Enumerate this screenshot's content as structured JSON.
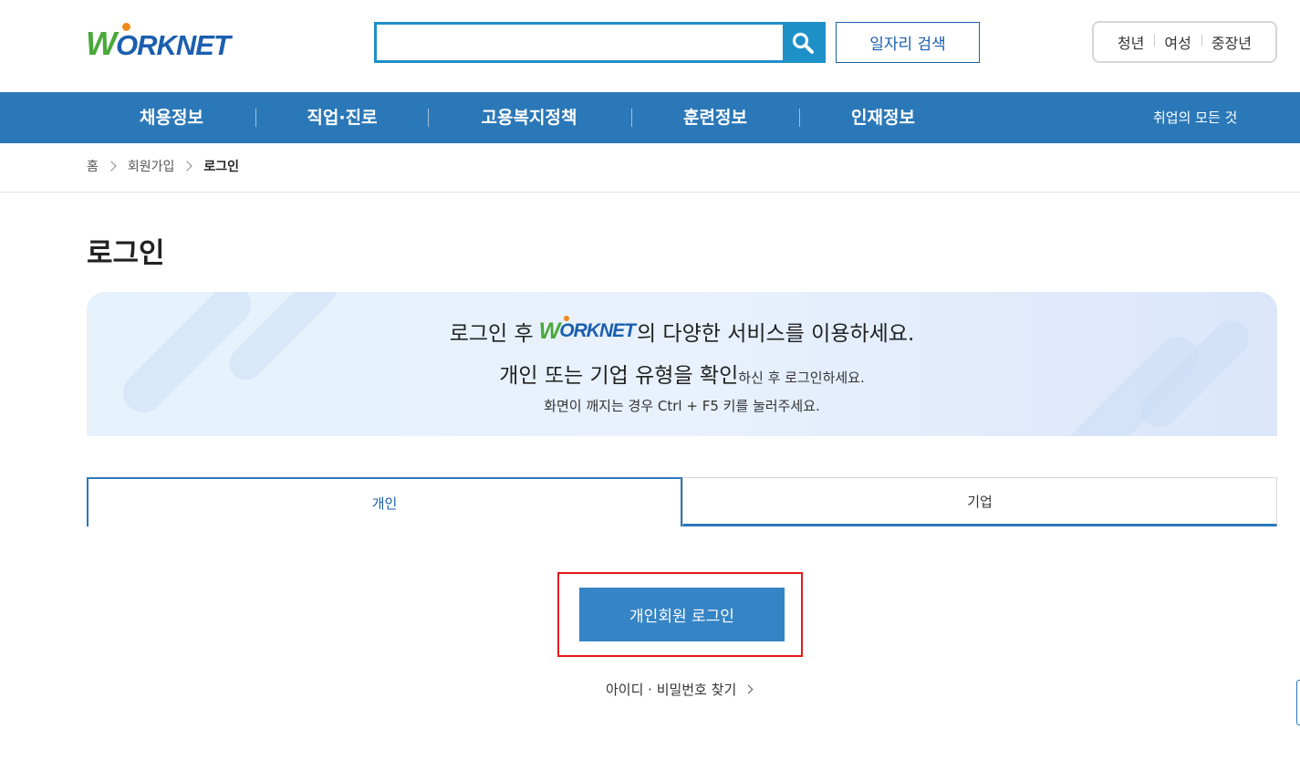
{
  "header": {
    "logo": {
      "w": "W",
      "o": "O",
      "rest": "RKNET"
    },
    "search": {
      "value": "",
      "placeholder": "",
      "icon": "search-icon"
    },
    "job_search_label": "일자리 검색",
    "audience": [
      "청년",
      "여성",
      "중장년"
    ]
  },
  "nav": {
    "items": [
      "채용정보",
      "직업·진로",
      "고용복지정책",
      "훈련정보",
      "인재정보"
    ],
    "extra": "취업의 모든 것"
  },
  "breadcrumb": {
    "home": "홈",
    "level1": "회원가입",
    "current": "로그인"
  },
  "page_title": "로그인",
  "banner": {
    "line1_before": "로그인 후",
    "line1_after": "의 다양한 서비스를 이용하세요.",
    "line2_big": "개인 또는 기업 유형을 확인",
    "line2_small": "하신 후 로그인하세요.",
    "line3": "화면이 깨지는 경우 Ctrl + F5 키를 눌러주세요."
  },
  "tabs": {
    "personal": "개인",
    "corporate": "기업",
    "active": "personal"
  },
  "login_button": "개인회원 로그인",
  "find_link": "아이디 · 비밀번호 찾기",
  "colors": {
    "nav": "#2b78b8",
    "brand_blue": "#1b5fae",
    "brand_green": "#4aa93a",
    "brand_orange": "#f08a1c",
    "login_button": "#3584c6",
    "highlight": "#e41b1b"
  }
}
